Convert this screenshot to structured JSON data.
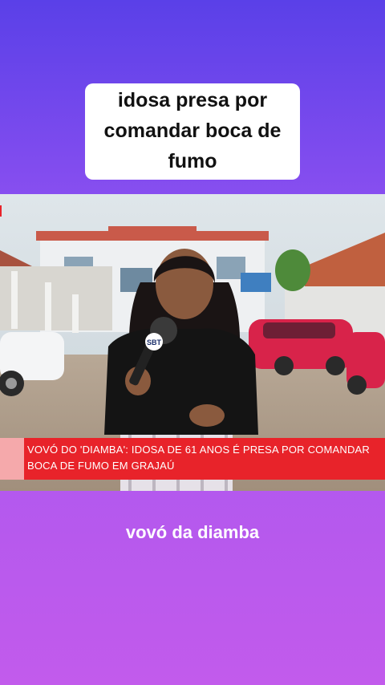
{
  "top_caption": {
    "line1": "idosa presa por",
    "line2": "comandar boca de",
    "line3": "fumo"
  },
  "video": {
    "mic_logo": "SBT",
    "ticker": {
      "line1": "VOVÓ DO 'DIAMBA': IDOSA DE 61 ANOS É PRESA POR COMANDAR",
      "line2": "BOCA DE FUMO EM GRAJAÚ"
    }
  },
  "bottom_caption": "vovó da diamba",
  "colors": {
    "background_top": "#5a40e8",
    "background_bottom": "#c25bec",
    "ticker_red": "#e8232a"
  }
}
